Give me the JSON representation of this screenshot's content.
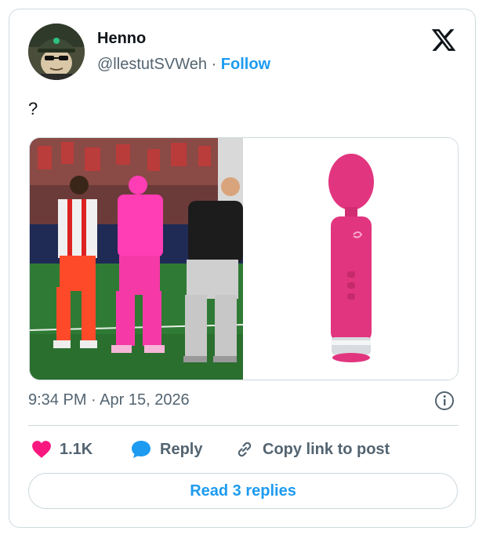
{
  "author": {
    "name": "Henno",
    "handle": "@llestutSVWeh",
    "separator": "·",
    "follow_label": "Follow"
  },
  "icons": {
    "brand": "x-logo-icon",
    "avatar": "avatar-image",
    "info": "info-icon",
    "like": "heart-icon",
    "reply": "speech-bubble-icon",
    "copy": "link-icon"
  },
  "tweet": {
    "text": "?",
    "timestamp": "9:34 PM · Apr 15, 2026"
  },
  "media": {
    "left_image": "photo of people standing on a soccer pitch",
    "right_image": "pink wand-style product photo"
  },
  "actions": {
    "likes_count": "1.1K",
    "reply_label": "Reply",
    "copy_label": "Copy link to post"
  },
  "read_replies_label": "Read 3 replies",
  "colors": {
    "accent": "#1d9bf0",
    "like": "#f91880",
    "text": "#0f1419",
    "muted": "#536471",
    "border": "#cfd9de",
    "product_pink": "#e2357f"
  }
}
